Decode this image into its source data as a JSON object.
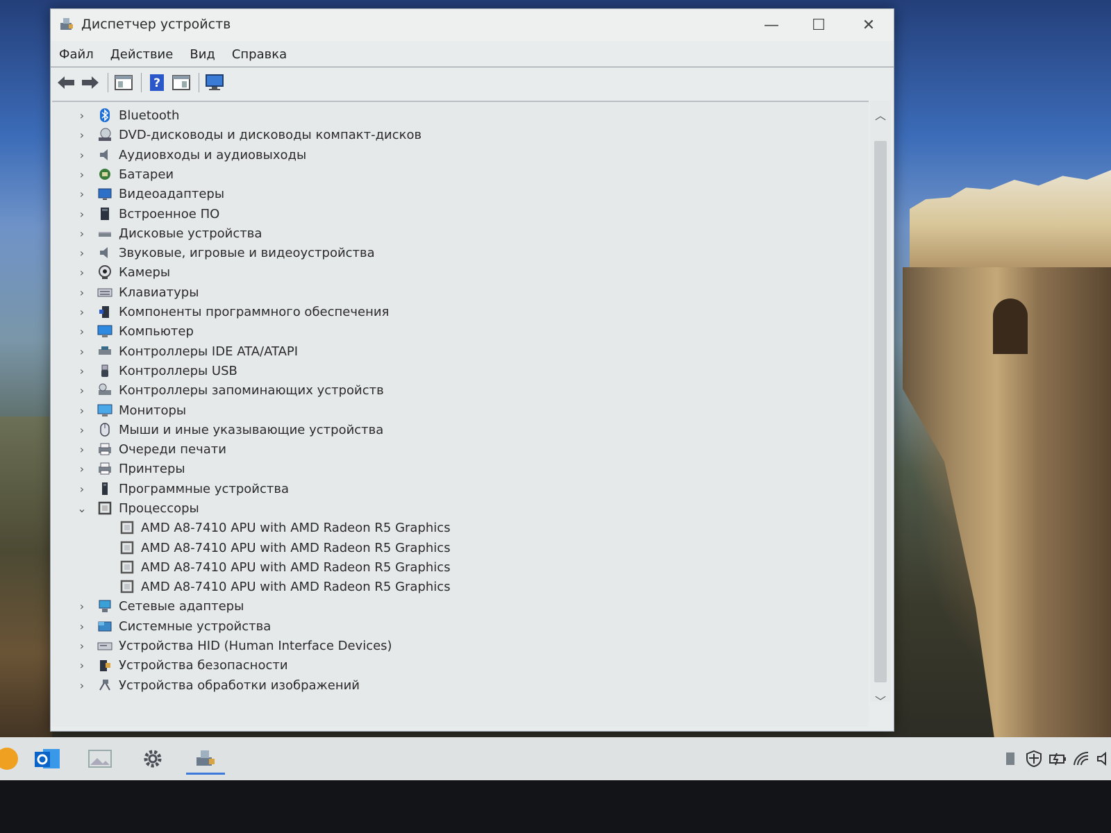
{
  "window": {
    "title": "Диспетчер устройств",
    "controls": {
      "minimize": "—",
      "maximize": "☐",
      "close": "✕"
    }
  },
  "menu": [
    "Файл",
    "Действие",
    "Вид",
    "Справка"
  ],
  "toolbar": [
    "back-arrow",
    "forward-arrow",
    "properties",
    "help",
    "show-hidden",
    "monitor"
  ],
  "tree": {
    "categories": [
      {
        "label": "Bluetooth",
        "icon": "bluetooth-icon",
        "expanded": false
      },
      {
        "label": "DVD-дисководы и дисководы компакт-дисков",
        "icon": "dvd-drive-icon",
        "expanded": false
      },
      {
        "label": "Аудиовходы и аудиовыходы",
        "icon": "audio-io-icon",
        "expanded": false
      },
      {
        "label": "Батареи",
        "icon": "battery-icon",
        "expanded": false
      },
      {
        "label": "Видеоадаптеры",
        "icon": "display-adapter-icon",
        "expanded": false
      },
      {
        "label": "Встроенное ПО",
        "icon": "firmware-icon",
        "expanded": false
      },
      {
        "label": "Дисковые устройства",
        "icon": "disk-drive-icon",
        "expanded": false
      },
      {
        "label": "Звуковые, игровые и видеоустройства",
        "icon": "sound-icon",
        "expanded": false
      },
      {
        "label": "Камеры",
        "icon": "camera-icon",
        "expanded": false
      },
      {
        "label": "Клавиатуры",
        "icon": "keyboard-icon",
        "expanded": false
      },
      {
        "label": "Компоненты программного обеспечения",
        "icon": "software-component-icon",
        "expanded": false
      },
      {
        "label": "Компьютер",
        "icon": "computer-icon",
        "expanded": false
      },
      {
        "label": "Контроллеры IDE ATA/ATAPI",
        "icon": "ide-controller-icon",
        "expanded": false
      },
      {
        "label": "Контроллеры USB",
        "icon": "usb-icon",
        "expanded": false
      },
      {
        "label": "Контроллеры запоминающих устройств",
        "icon": "storage-controller-icon",
        "expanded": false
      },
      {
        "label": "Мониторы",
        "icon": "monitor-icon",
        "expanded": false
      },
      {
        "label": "Мыши и иные указывающие устройства",
        "icon": "mouse-icon",
        "expanded": false
      },
      {
        "label": "Очереди печати",
        "icon": "print-queue-icon",
        "expanded": false
      },
      {
        "label": "Принтеры",
        "icon": "printer-icon",
        "expanded": false
      },
      {
        "label": "Программные устройства",
        "icon": "software-device-icon",
        "expanded": false
      },
      {
        "label": "Процессоры",
        "icon": "processor-icon",
        "expanded": true,
        "children": [
          "AMD A8-7410 APU with AMD Radeon R5 Graphics",
          "AMD A8-7410 APU with AMD Radeon R5 Graphics",
          "AMD A8-7410 APU with AMD Radeon R5 Graphics",
          "AMD A8-7410 APU with AMD Radeon R5 Graphics"
        ]
      },
      {
        "label": "Сетевые адаптеры",
        "icon": "network-adapter-icon",
        "expanded": false
      },
      {
        "label": "Системные устройства",
        "icon": "system-device-icon",
        "expanded": false
      },
      {
        "label": "Устройства HID (Human Interface Devices)",
        "icon": "hid-icon",
        "expanded": false
      },
      {
        "label": "Устройства безопасности",
        "icon": "security-device-icon",
        "expanded": false
      },
      {
        "label": "Устройства обработки изображений",
        "icon": "imaging-device-icon",
        "expanded": false
      }
    ]
  },
  "taskbar": {
    "apps": [
      "outlook-icon",
      "photos-icon",
      "settings-gear-icon",
      "device-manager-icon"
    ],
    "tray": [
      "tray-flag-icon",
      "defender-shield-icon",
      "battery-charging-icon",
      "wifi-icon",
      "volume-icon"
    ]
  },
  "colors": {
    "accent": "#3b7ad8",
    "window_bg": "#e6e9e9"
  }
}
